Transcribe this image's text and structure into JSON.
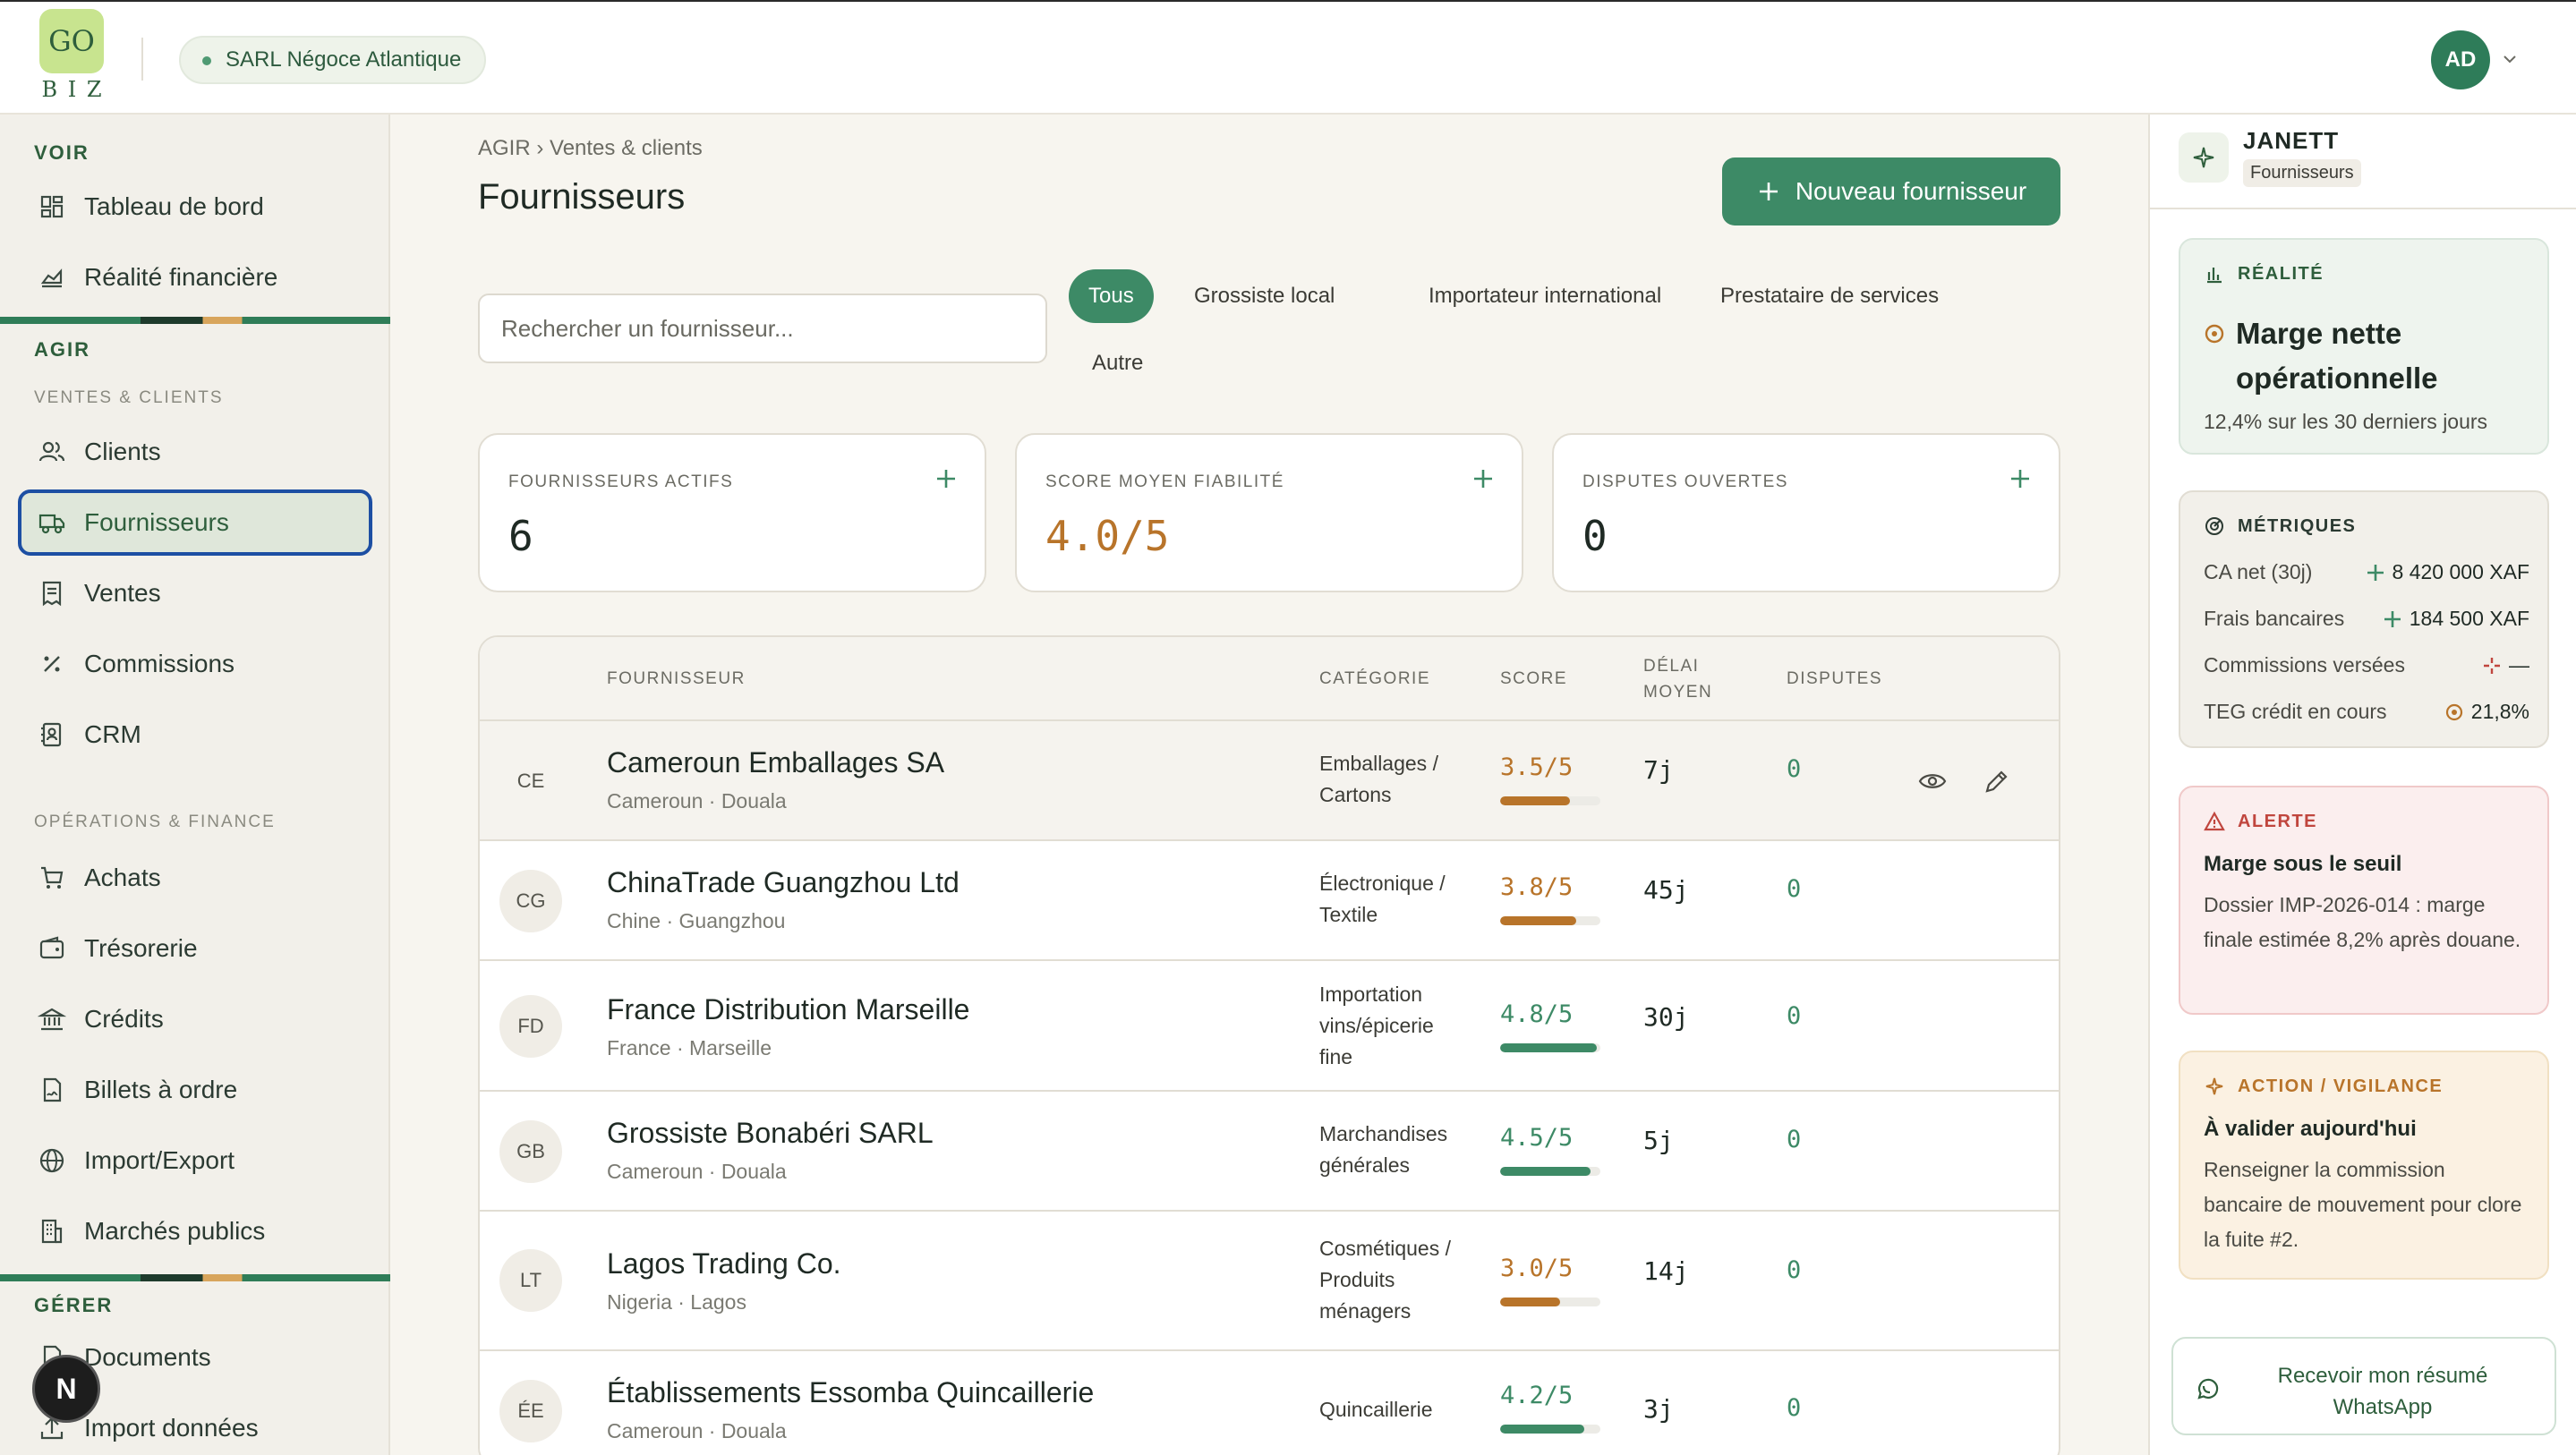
{
  "header": {
    "logo_top": "GO",
    "logo_bottom": "B I Z",
    "company": "SARL Négoce Atlantique",
    "user_initials": "AD"
  },
  "sidebar": {
    "voir_title": "VOIR",
    "voir_items": [
      "Tableau de bord",
      "Réalité financière"
    ],
    "agir_title": "AGIR",
    "ventes_sub": "VENTES & CLIENTS",
    "ventes_items": [
      "Clients",
      "Fournisseurs",
      "Ventes",
      "Commissions",
      "CRM"
    ],
    "ops_sub": "OPÉRATIONS & FINANCE",
    "ops_items": [
      "Achats",
      "Trésorerie",
      "Crédits",
      "Billets à ordre",
      "Import/Export",
      "Marchés publics"
    ],
    "gerer_title": "GÉRER",
    "gerer_items": [
      "Documents",
      "Import données"
    ],
    "active_item": "Fournisseurs",
    "floating_badge": "N"
  },
  "main": {
    "breadcrumb": "AGIR › Ventes & clients",
    "title": "Fournisseurs",
    "new_button": "Nouveau fournisseur",
    "search_placeholder": "Rechercher un fournisseur...",
    "filters": [
      "Tous",
      "Grossiste local",
      "Importateur international",
      "Prestataire de services",
      "Autre"
    ],
    "active_filter": "Tous",
    "kpis": [
      {
        "label": "FOURNISSEURS ACTIFS",
        "value": "6"
      },
      {
        "label": "SCORE MOYEN FIABILITÉ",
        "value": "4.0/5"
      },
      {
        "label": "DISPUTES OUVERTES",
        "value": "0"
      }
    ],
    "table": {
      "headers": {
        "supplier": "FOURNISSEUR",
        "category": "CATÉGORIE",
        "score": "SCORE",
        "delay": "DÉLAI MOYEN",
        "disputes": "DISPUTES"
      },
      "rows": [
        {
          "initials": "CE",
          "name": "Cameroun Emballages SA",
          "location": "Cameroun · Douala",
          "category": "Emballages / Cartons",
          "score": "3.5/5",
          "score_value": 3.5,
          "delay": "7j",
          "disputes": "0"
        },
        {
          "initials": "CG",
          "name": "ChinaTrade Guangzhou Ltd",
          "location": "Chine · Guangzhou",
          "category": "Électronique / Textile",
          "score": "3.8/5",
          "score_value": 3.8,
          "delay": "45j",
          "disputes": "0"
        },
        {
          "initials": "FD",
          "name": "France Distribution Marseille",
          "location": "France · Marseille",
          "category": "Importation vins/épicerie fine",
          "score": "4.8/5",
          "score_value": 4.8,
          "delay": "30j",
          "disputes": "0"
        },
        {
          "initials": "GB",
          "name": "Grossiste Bonabéri SARL",
          "location": "Cameroun · Douala",
          "category": "Marchandises générales",
          "score": "4.5/5",
          "score_value": 4.5,
          "delay": "5j",
          "disputes": "0"
        },
        {
          "initials": "LT",
          "name": "Lagos Trading Co.",
          "location": "Nigeria · Lagos",
          "category": "Cosmétiques / Produits ménagers",
          "score": "3.0/5",
          "score_value": 3.0,
          "delay": "14j",
          "disputes": "0"
        },
        {
          "initials": "ÉE",
          "name": "Établissements Essomba Quincaillerie",
          "location": "Cameroun · Douala",
          "category": "Quincaillerie",
          "score": "4.2/5",
          "score_value": 4.2,
          "delay": "3j",
          "disputes": "0"
        }
      ]
    }
  },
  "assistant": {
    "name": "JANETT",
    "context": "Fournisseurs",
    "reality_title": "RÉALITÉ",
    "reality_main": "Marge nette opérationnelle",
    "reality_sub": "12,4% sur les 30 derniers jours",
    "metrics_title": "MÉTRIQUES",
    "metrics": [
      {
        "label": "CA net (30j)",
        "value": "8 420 000 XAF"
      },
      {
        "label": "Frais bancaires",
        "value": "184 500 XAF"
      },
      {
        "label": "Commissions versées",
        "value": "—"
      },
      {
        "label": "TEG crédit en cours",
        "value": "21,8%"
      }
    ],
    "alert_title": "ALERTE",
    "alert_head": "Marge sous le seuil",
    "alert_body": "Dossier IMP-2026-014 : marge finale estimée 8,2% après douane.",
    "action_title": "ACTION / VIGILANCE",
    "action_head": "À valider aujourd'hui",
    "action_body": "Renseigner la commission bancaire de mouvement pour clore la fuite #2.",
    "whatsapp_button": "Recevoir mon résumé WhatsApp"
  },
  "colors": {
    "accent": "#3d8a66",
    "gold": "#b8742a",
    "alert": "#c0463e",
    "focus": "#1d4fa3"
  }
}
